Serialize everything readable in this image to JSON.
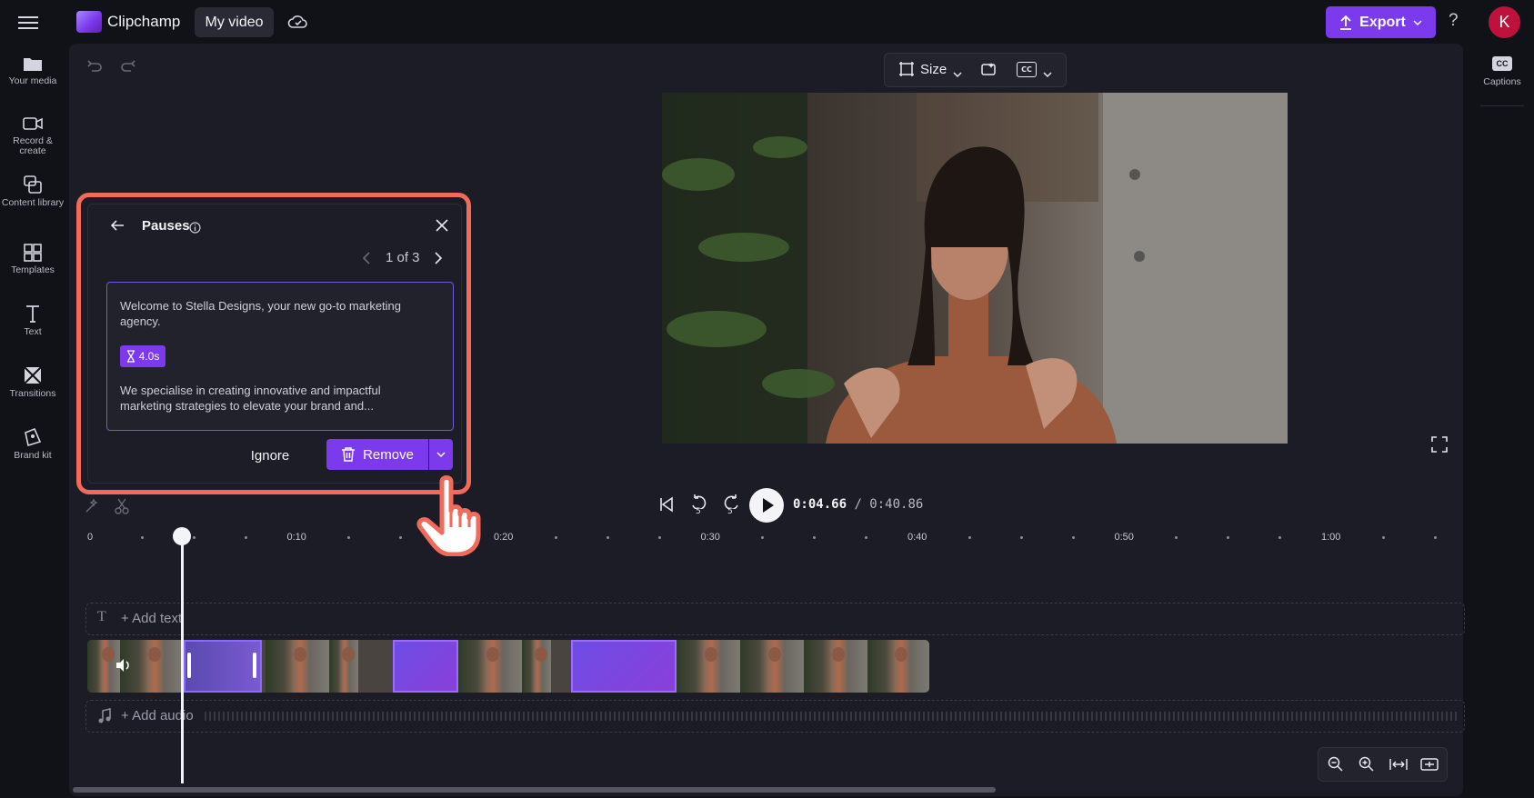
{
  "header": {
    "app_name": "Clipchamp",
    "project_title": "My video",
    "export_label": "Export",
    "help_label": "?",
    "avatar_initial": "K"
  },
  "left_rail": [
    {
      "label": "Your media",
      "icon": "folder-icon"
    },
    {
      "label": "Record & create",
      "icon": "camera-icon"
    },
    {
      "label": "Content library",
      "icon": "content-library-icon"
    },
    {
      "label": "Templates",
      "icon": "templates-icon"
    },
    {
      "label": "Text",
      "icon": "text-icon"
    },
    {
      "label": "Transitions",
      "icon": "transitions-icon"
    },
    {
      "label": "Brand kit",
      "icon": "brand-kit-icon"
    }
  ],
  "right_rail": {
    "captions_label": "Captions",
    "captions_badge": "CC"
  },
  "preview_toolbar": {
    "size_label": "Size",
    "cc_label": "CC"
  },
  "pauses_panel": {
    "title": "Pauses",
    "pager": "1 of 3",
    "transcript_before": "Welcome to Stella Designs, your new go-to marketing agency.",
    "pause_duration": "4.0s",
    "transcript_after": "We specialise in creating innovative and impactful marketing strategies to elevate your brand and...",
    "ignore_label": "Ignore",
    "remove_label": "Remove"
  },
  "playback": {
    "current_time": "0:04.66",
    "total_time": "/ 0:40.86",
    "skip_back_seconds": "5",
    "skip_forward_seconds": "5"
  },
  "timeline": {
    "ruler_labels": [
      "0",
      "0:10",
      "0:20",
      "0:30",
      "0:40",
      "0:50",
      "1:00"
    ],
    "add_text_label": "+ Add text",
    "add_audio_label": "+ Add audio"
  },
  "colors": {
    "accent": "#7c3aed",
    "highlight": "#f26a5a",
    "panel_bg": "#1c1c26",
    "app_bg": "#111118"
  }
}
